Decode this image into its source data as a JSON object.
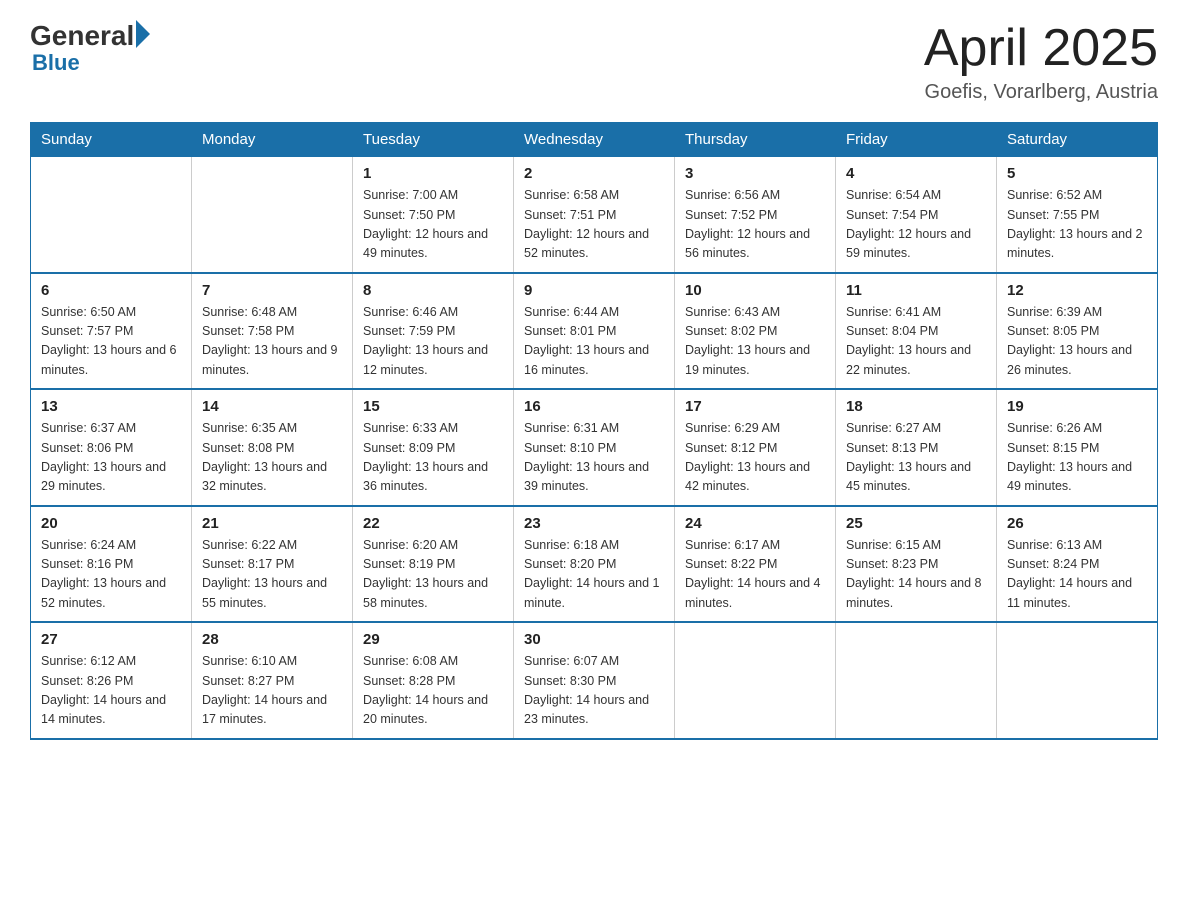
{
  "header": {
    "logo_general": "General",
    "logo_blue": "Blue",
    "title": "April 2025",
    "subtitle": "Goefis, Vorarlberg, Austria"
  },
  "days_header": [
    "Sunday",
    "Monday",
    "Tuesday",
    "Wednesday",
    "Thursday",
    "Friday",
    "Saturday"
  ],
  "weeks": [
    [
      {
        "day": "",
        "info": ""
      },
      {
        "day": "",
        "info": ""
      },
      {
        "day": "1",
        "info": "Sunrise: 7:00 AM\nSunset: 7:50 PM\nDaylight: 12 hours\nand 49 minutes."
      },
      {
        "day": "2",
        "info": "Sunrise: 6:58 AM\nSunset: 7:51 PM\nDaylight: 12 hours\nand 52 minutes."
      },
      {
        "day": "3",
        "info": "Sunrise: 6:56 AM\nSunset: 7:52 PM\nDaylight: 12 hours\nand 56 minutes."
      },
      {
        "day": "4",
        "info": "Sunrise: 6:54 AM\nSunset: 7:54 PM\nDaylight: 12 hours\nand 59 minutes."
      },
      {
        "day": "5",
        "info": "Sunrise: 6:52 AM\nSunset: 7:55 PM\nDaylight: 13 hours\nand 2 minutes."
      }
    ],
    [
      {
        "day": "6",
        "info": "Sunrise: 6:50 AM\nSunset: 7:57 PM\nDaylight: 13 hours\nand 6 minutes."
      },
      {
        "day": "7",
        "info": "Sunrise: 6:48 AM\nSunset: 7:58 PM\nDaylight: 13 hours\nand 9 minutes."
      },
      {
        "day": "8",
        "info": "Sunrise: 6:46 AM\nSunset: 7:59 PM\nDaylight: 13 hours\nand 12 minutes."
      },
      {
        "day": "9",
        "info": "Sunrise: 6:44 AM\nSunset: 8:01 PM\nDaylight: 13 hours\nand 16 minutes."
      },
      {
        "day": "10",
        "info": "Sunrise: 6:43 AM\nSunset: 8:02 PM\nDaylight: 13 hours\nand 19 minutes."
      },
      {
        "day": "11",
        "info": "Sunrise: 6:41 AM\nSunset: 8:04 PM\nDaylight: 13 hours\nand 22 minutes."
      },
      {
        "day": "12",
        "info": "Sunrise: 6:39 AM\nSunset: 8:05 PM\nDaylight: 13 hours\nand 26 minutes."
      }
    ],
    [
      {
        "day": "13",
        "info": "Sunrise: 6:37 AM\nSunset: 8:06 PM\nDaylight: 13 hours\nand 29 minutes."
      },
      {
        "day": "14",
        "info": "Sunrise: 6:35 AM\nSunset: 8:08 PM\nDaylight: 13 hours\nand 32 minutes."
      },
      {
        "day": "15",
        "info": "Sunrise: 6:33 AM\nSunset: 8:09 PM\nDaylight: 13 hours\nand 36 minutes."
      },
      {
        "day": "16",
        "info": "Sunrise: 6:31 AM\nSunset: 8:10 PM\nDaylight: 13 hours\nand 39 minutes."
      },
      {
        "day": "17",
        "info": "Sunrise: 6:29 AM\nSunset: 8:12 PM\nDaylight: 13 hours\nand 42 minutes."
      },
      {
        "day": "18",
        "info": "Sunrise: 6:27 AM\nSunset: 8:13 PM\nDaylight: 13 hours\nand 45 minutes."
      },
      {
        "day": "19",
        "info": "Sunrise: 6:26 AM\nSunset: 8:15 PM\nDaylight: 13 hours\nand 49 minutes."
      }
    ],
    [
      {
        "day": "20",
        "info": "Sunrise: 6:24 AM\nSunset: 8:16 PM\nDaylight: 13 hours\nand 52 minutes."
      },
      {
        "day": "21",
        "info": "Sunrise: 6:22 AM\nSunset: 8:17 PM\nDaylight: 13 hours\nand 55 minutes."
      },
      {
        "day": "22",
        "info": "Sunrise: 6:20 AM\nSunset: 8:19 PM\nDaylight: 13 hours\nand 58 minutes."
      },
      {
        "day": "23",
        "info": "Sunrise: 6:18 AM\nSunset: 8:20 PM\nDaylight: 14 hours\nand 1 minute."
      },
      {
        "day": "24",
        "info": "Sunrise: 6:17 AM\nSunset: 8:22 PM\nDaylight: 14 hours\nand 4 minutes."
      },
      {
        "day": "25",
        "info": "Sunrise: 6:15 AM\nSunset: 8:23 PM\nDaylight: 14 hours\nand 8 minutes."
      },
      {
        "day": "26",
        "info": "Sunrise: 6:13 AM\nSunset: 8:24 PM\nDaylight: 14 hours\nand 11 minutes."
      }
    ],
    [
      {
        "day": "27",
        "info": "Sunrise: 6:12 AM\nSunset: 8:26 PM\nDaylight: 14 hours\nand 14 minutes."
      },
      {
        "day": "28",
        "info": "Sunrise: 6:10 AM\nSunset: 8:27 PM\nDaylight: 14 hours\nand 17 minutes."
      },
      {
        "day": "29",
        "info": "Sunrise: 6:08 AM\nSunset: 8:28 PM\nDaylight: 14 hours\nand 20 minutes."
      },
      {
        "day": "30",
        "info": "Sunrise: 6:07 AM\nSunset: 8:30 PM\nDaylight: 14 hours\nand 23 minutes."
      },
      {
        "day": "",
        "info": ""
      },
      {
        "day": "",
        "info": ""
      },
      {
        "day": "",
        "info": ""
      }
    ]
  ]
}
